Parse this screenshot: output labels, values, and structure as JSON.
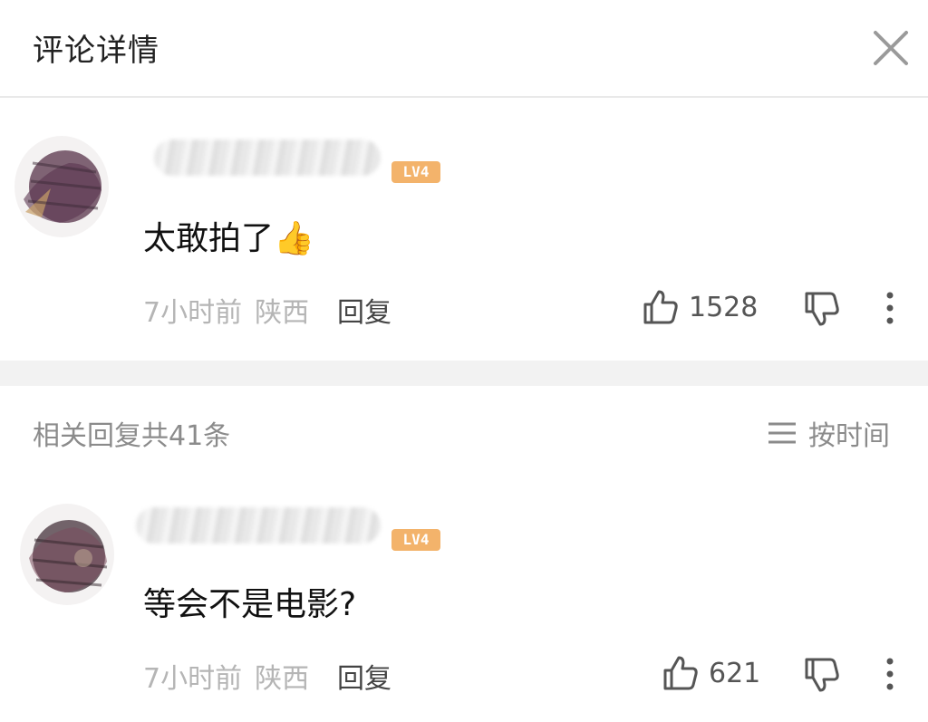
{
  "header": {
    "title": "评论详情",
    "close_icon": "close-icon"
  },
  "main_comment": {
    "level": "LV4",
    "text": "太敢拍了👍",
    "time": "7小时前",
    "location": "陕西",
    "reply_label": "回复",
    "like_count": "1528"
  },
  "replies_bar": {
    "count_label": "相关回复共41条",
    "sort_label": "按时间"
  },
  "replies": [
    {
      "level": "LV4",
      "text": "等会不是电影?",
      "time": "7小时前",
      "location": "陕西",
      "reply_label": "回复",
      "like_count": "621"
    }
  ],
  "colors": {
    "level_badge": "#f3b36b",
    "separator": "#f2f2f2",
    "meta_text": "#b5b5b5"
  }
}
